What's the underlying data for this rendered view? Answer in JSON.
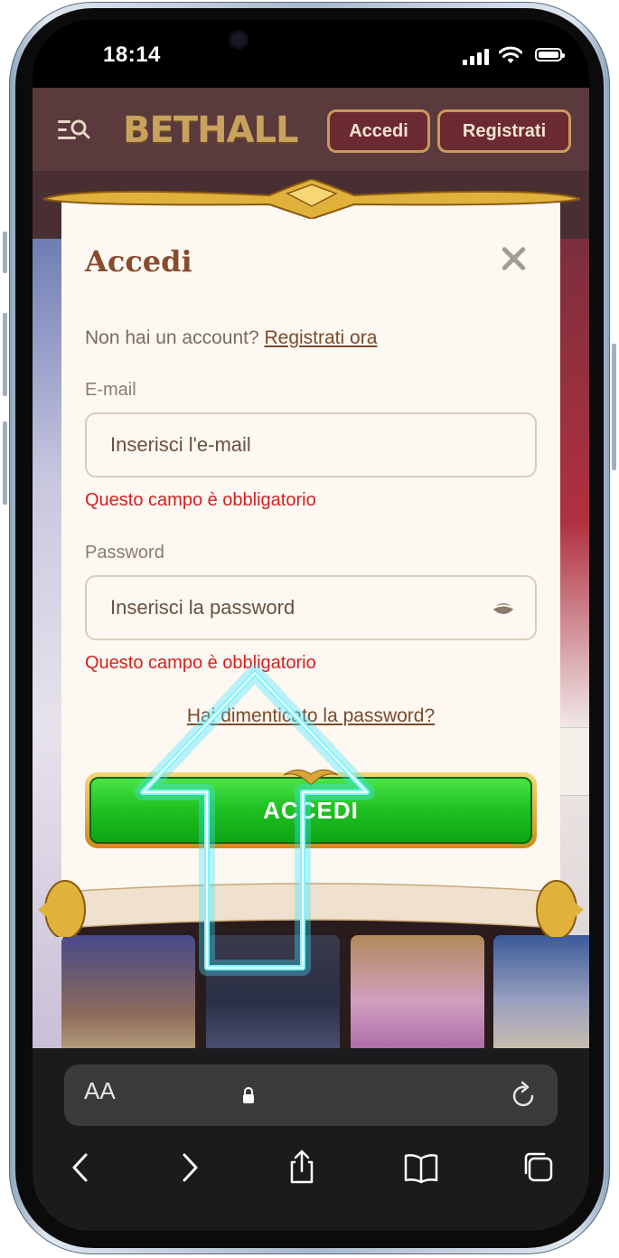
{
  "status_bar": {
    "time": "18:14"
  },
  "header": {
    "logo": "BETHALL",
    "login_label": "Accedi",
    "register_label": "Registrati",
    "menu_icon": "menu-search-icon"
  },
  "modal": {
    "title": "Accedi",
    "no_account_text": "Non hai un account?",
    "register_link": "Registrati ora",
    "email": {
      "label": "E-mail",
      "placeholder": "Inserisci l'e-mail",
      "error": "Questo campo è obbligatorio"
    },
    "password": {
      "label": "Password",
      "placeholder": "Inserisci la password",
      "error": "Questo campo è obbligatorio"
    },
    "forgot_link": "Hai dimenticato la password?",
    "submit_label": "ACCEDI"
  },
  "safari": {
    "text_size_label": "AA",
    "icons": [
      "lock-icon",
      "reload-icon",
      "back-icon",
      "forward-icon",
      "share-icon",
      "bookmarks-icon",
      "tabs-icon"
    ]
  },
  "colors": {
    "accent_brown": "#8a4a2e",
    "error_red": "#d42020",
    "button_green": "#21c323",
    "highlight_cyan": "#7ff6ff"
  }
}
